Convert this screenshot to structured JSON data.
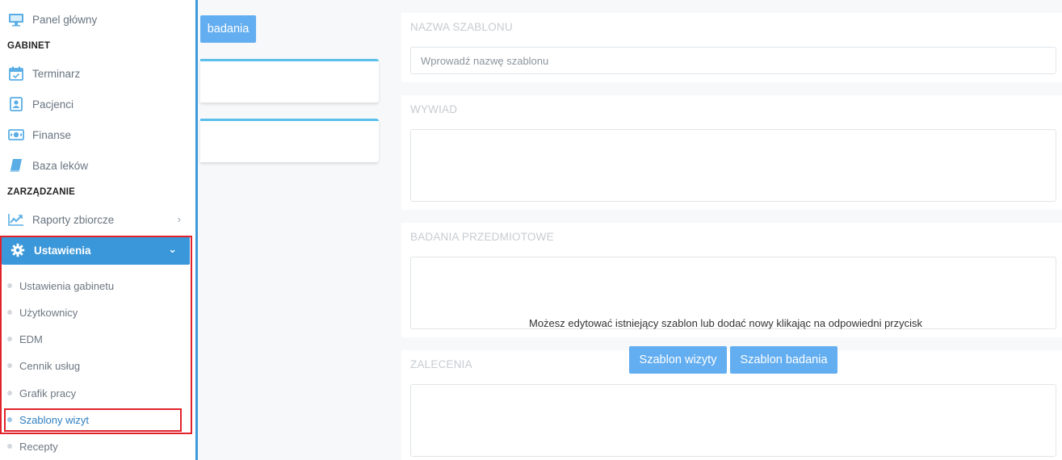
{
  "sidebar": {
    "dashboard_label": "Panel główny",
    "section_gabinet": "GABINET",
    "items": [
      {
        "label": "Terminarz",
        "icon": "calendar-icon"
      },
      {
        "label": "Pacjenci",
        "icon": "patient-icon"
      },
      {
        "label": "Finanse",
        "icon": "money-icon"
      },
      {
        "label": "Baza leków",
        "icon": "book-icon"
      }
    ],
    "section_zarzadzanie": "ZARZĄDZANIE",
    "reports_label": "Raporty zbiorcze",
    "settings_label": "Ustawienia",
    "settings_sub": [
      "Ustawienia gabinetu",
      "Użytkownicy",
      "EDM",
      "Cennik usług",
      "Grafik pracy",
      "Szablony wizyt",
      "Recepty"
    ]
  },
  "middle": {
    "top_button_label": "badania"
  },
  "form": {
    "name_label": "NAZWA SZABLONU",
    "name_placeholder": "Wprowadź nazwę szablonu",
    "interview_label": "WYWIAD",
    "exam_label": "BADANIA PRZEDMIOTOWE",
    "recommendations_label": "ZALECENIA"
  },
  "overlay": {
    "message": "Możesz edytować istniejący szablon lub dodać nowy klikając na odpowiedni przycisk",
    "visit_template_button": "Szablon wizyty",
    "exam_template_button": "Szablon badania"
  },
  "colors": {
    "accent": "#3a97d9",
    "button": "#63aef0",
    "highlight": "#e0232b"
  }
}
